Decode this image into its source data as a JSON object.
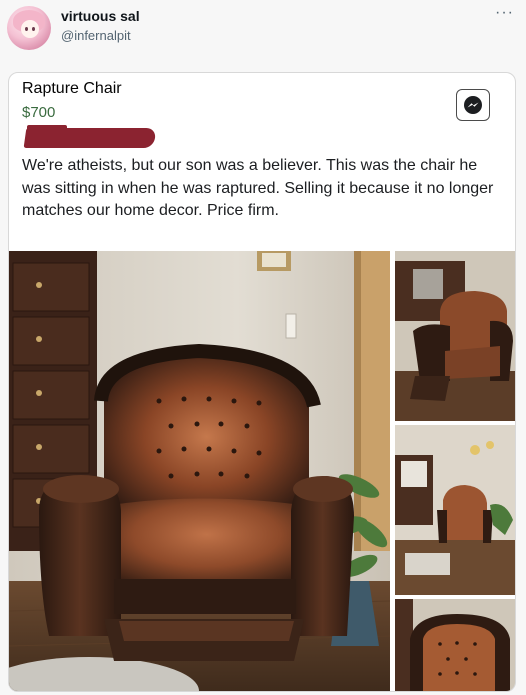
{
  "post": {
    "display_name": "virtuous sal",
    "handle": "@infernalpit",
    "more_icon": "more-horizontal-icon",
    "more_glyph": "···"
  },
  "listing": {
    "title": "Rapture Chair",
    "price": "$700",
    "description": "We're atheists, but our son was a believer. This was the chair he was sitting in when he was raptured. Selling it because it no longer matches our home decor. Price firm.",
    "messenger_icon": "messenger-icon",
    "redaction_color": "#8b2330"
  },
  "colors": {
    "price_green": "#3a6b3f",
    "leather_dark": "#3a2418",
    "leather_tan": "#a35a35",
    "wall": "#d9d3c8"
  }
}
